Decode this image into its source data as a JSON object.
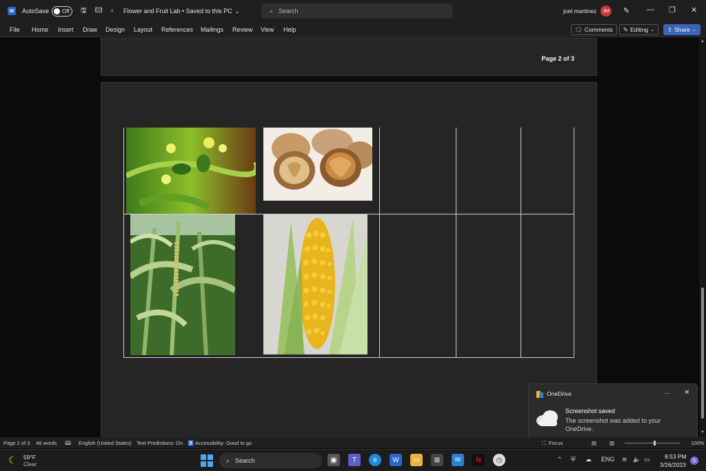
{
  "titlebar": {
    "autosave_label": "AutoSave",
    "autosave_state": "Off",
    "doc_title": "Flower and Fruit Lab • Saved to this PC",
    "search_placeholder": "Search",
    "user_name": "joel martinez",
    "user_initials": "JM"
  },
  "ribbon": {
    "tabs": [
      "File",
      "Home",
      "Insert",
      "Draw",
      "Design",
      "Layout",
      "References",
      "Mailings",
      "Review",
      "View",
      "Help"
    ],
    "comments_label": "Comments",
    "editing_label": "Editing",
    "share_label": "Share"
  },
  "document": {
    "page_label": "Page 2 of 3",
    "images": {
      "walnut_flower": "walnut flower photo",
      "walnuts": "walnuts photo",
      "corn_plant": "corn plant photo",
      "corn_cob": "corn cob photo"
    }
  },
  "toast": {
    "app": "OneDrive",
    "title": "Screenshot saved",
    "message": "The screenshot was added to your OneDrive."
  },
  "statusbar": {
    "page": "Page 2 of 3",
    "words": "48 words",
    "language": "English (United States)",
    "predictions": "Text Predictions: On",
    "accessibility": "Accessibility: Good to go",
    "focus": "Focus",
    "zoom": "100%"
  },
  "taskbar": {
    "temperature": "59°F",
    "condition": "Clear",
    "search_label": "Search",
    "language": "ENG",
    "time": "8:53 PM",
    "date": "3/26/2023",
    "notification_count": "5"
  },
  "colors": {
    "accent": "#3a64b6",
    "page_bg": "#252525",
    "app_bg": "#0b0b0b"
  }
}
